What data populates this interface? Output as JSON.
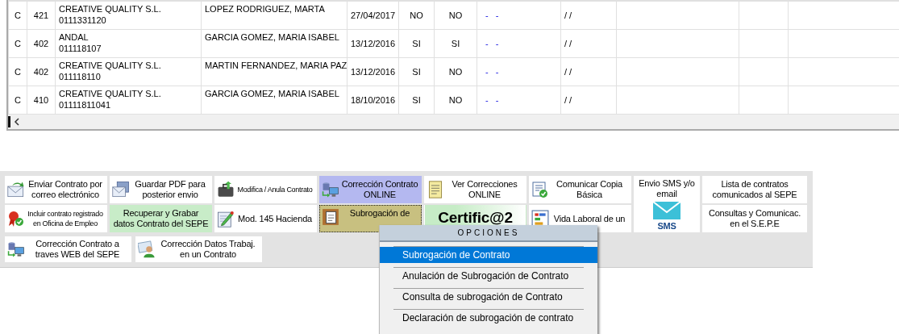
{
  "table": {
    "rows": [
      {
        "type": "C",
        "code": "421",
        "company": "CREATIVE QUALITY S.L.",
        "company_code": "0111331120",
        "worker": "LOPEZ RODRIGUEZ, MARTA",
        "date": "27/04/2017",
        "column_7": "NO",
        "column_8": "NO",
        "column_9": "-   -",
        "column_10": "/ /"
      },
      {
        "type": "C",
        "code": "402",
        "company": "ANDAL",
        "company_code": "011118107",
        "worker": "GARCIA GOMEZ, MARIA ISABEL",
        "date": "13/12/2016",
        "column_7": "SI",
        "column_8": "SI",
        "column_9": "-   -",
        "column_10": "/ /"
      },
      {
        "type": "C",
        "code": "402",
        "company": "CREATIVE QUALITY S.L.",
        "company_code": "011118110",
        "worker": "MARTIN FERNANDEZ, MARIA PAZ",
        "date": "13/12/2016",
        "column_7": "SI",
        "column_8": "NO",
        "column_9": "-   -",
        "column_10": "/ /"
      },
      {
        "type": "C",
        "code": "410",
        "company": "CREATIVE QUALITY S.L.",
        "company_code": "01111811041",
        "worker": "GARCIA GOMEZ, MARIA ISABEL",
        "date": "18/10/2016",
        "column_7": "SI",
        "column_8": "NO",
        "column_9": "-   -",
        "column_10": "/ /"
      }
    ]
  },
  "toolbar": {
    "buttons": [
      {
        "kind": "normal",
        "label": "Enviar Contrato por correo electrónico",
        "color": "#ffffff",
        "focused": false
      },
      {
        "kind": "normal",
        "label": "Guardar PDF para posterior envio",
        "color": "#ffffff",
        "focused": false
      },
      {
        "kind": "small",
        "label": "Modifica / Anula Contrato",
        "color": "#ffffff",
        "focused": false
      },
      {
        "kind": "normal",
        "label": "Corrección Contrato ONLINE",
        "color": "#b4b8f0",
        "focused": false
      },
      {
        "kind": "normal",
        "label": "Ver Correcciones ONLINE",
        "color": "#ffffff",
        "focused": false
      },
      {
        "kind": "normal",
        "label": "Comunicar Copia Básica",
        "color": "#ffffff",
        "focused": false
      },
      {
        "kind": "sms",
        "label": "Envio SMS y/o email",
        "badge": "SMS",
        "color": "#ffffff",
        "focused": false
      },
      {
        "kind": "normal",
        "label": "Lista de contratos comunicados al SEPE",
        "color": "#ffffff",
        "focused": false
      },
      {
        "kind": "small",
        "label": "Incluir contrato registrado en Oficina de Empleo",
        "color": "#ffffff",
        "focused": false
      },
      {
        "kind": "normal",
        "label": "Recuperar y Grabar datos Contrato del SEPE",
        "color": "#c8ecc8",
        "focused": false
      },
      {
        "kind": "normal",
        "label": "Mod. 145 Hacienda",
        "color": "#ffffff",
        "focused": false
      },
      {
        "kind": "normal",
        "label": "Subrogación de",
        "color": "#c8c080",
        "focused": true
      },
      {
        "kind": "large",
        "label": "Certific@2",
        "color": "#c6ecc6",
        "focused": false
      },
      {
        "kind": "normal",
        "label": "Vida Laboral de un",
        "color": "#ffffff",
        "focused": false
      },
      {
        "kind": "normal",
        "label": "Consultas y Comunicac. en el S.E.P.E",
        "color": "#ffffff",
        "focused": false
      }
    ],
    "bottom_buttons": [
      {
        "label": "Corrección Contrato a traves WEB del SEPE"
      },
      {
        "label": "Corrección Datos Trabaj. en un Contrato"
      }
    ]
  },
  "menu": {
    "title": "OPCIONES",
    "items": [
      {
        "label": "Subrogación de Contrato",
        "selected": true
      },
      {
        "label": "Anulación de Subrogación de Contrato",
        "selected": false
      },
      {
        "label": "Consulta de subrogación de Contrato",
        "selected": false
      },
      {
        "label": "Declaración de subrogación de contrato",
        "selected": false
      }
    ]
  }
}
